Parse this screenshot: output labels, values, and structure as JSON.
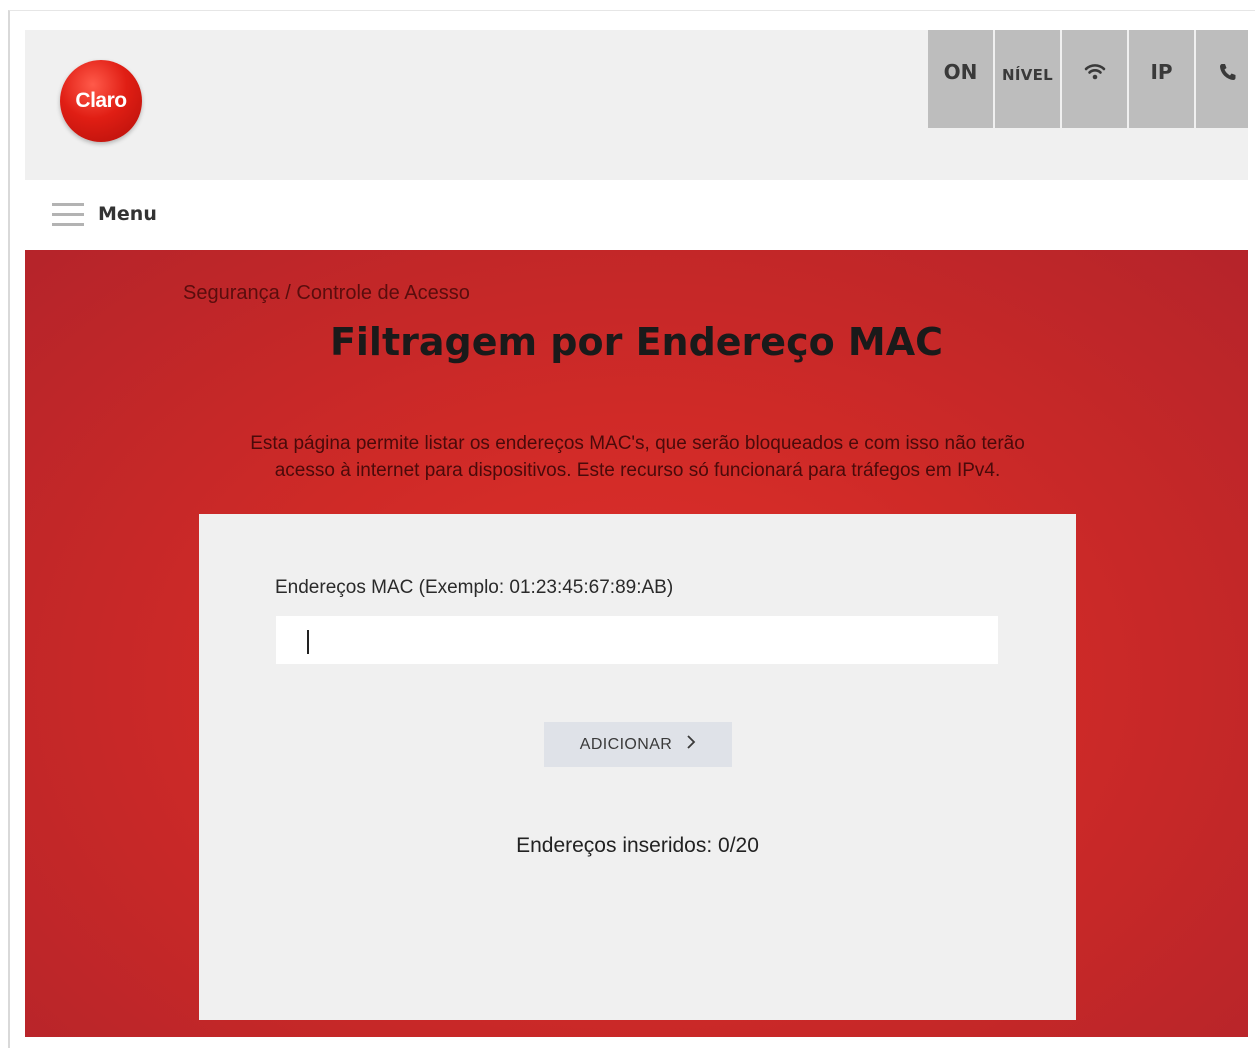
{
  "header": {
    "logo_text": "Claro",
    "status": {
      "on_label": "ON",
      "nivel_label": "NÍVEL",
      "wifi_icon": "wifi-icon",
      "ip_label": "IP",
      "phone_icon": "phone-icon"
    }
  },
  "menu": {
    "label": "Menu",
    "icon": "hamburger-menu-icon"
  },
  "main": {
    "breadcrumb": "Segurança / Controle de Acesso",
    "title": "Filtragem por Endereço MAC",
    "description_line1": "Esta página permite listar os endereços MAC's, que serão bloqueados e com isso não terão",
    "description_line2": "acesso à internet para dispositivos. Este recurso só funcionará para tráfegos em IPv4.",
    "form": {
      "mac_label": "Endereços MAC (Exemplo: 01:23:45:67:89:AB)",
      "mac_value": "",
      "add_button_label": "ADICIONAR",
      "add_button_icon": "chevron-right-icon",
      "count_text": "Endereços inseridos: 0/20"
    }
  },
  "colors": {
    "brand_red": "#cf2a27",
    "status_gray": "#bdbdbd",
    "panel_bg": "#f0f0f0",
    "button_bg": "#dfe2e8"
  }
}
